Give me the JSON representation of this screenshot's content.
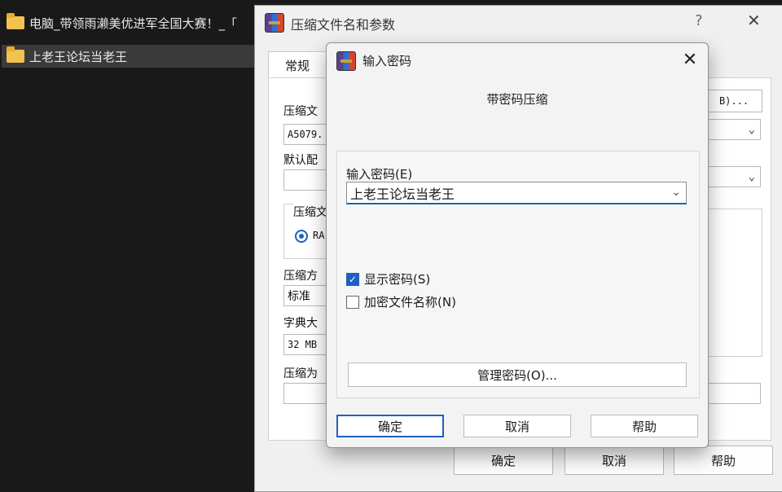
{
  "explorer": {
    "items": [
      {
        "label": "电脑_带领雨濑美优进军全国大赛！_「"
      },
      {
        "label": "上老王论坛当老王"
      }
    ]
  },
  "main_dialog": {
    "title": "压缩文件名和参数",
    "help": "?",
    "close": "✕",
    "tabs": {
      "general": "常规"
    },
    "labels": {
      "archive_name": "压缩文",
      "default_profile": "默认配",
      "archive_format": "压缩文",
      "compression_method": "压缩方",
      "dictionary_size": "字典大",
      "split": "压缩为"
    },
    "values": {
      "archive_name": "A5079.",
      "compression_method": "标准",
      "dictionary_size": "32 MB",
      "format_radio": "RA"
    },
    "right_button": "B)...",
    "bottom_buttons": {
      "ok": "确定",
      "cancel": "取消",
      "help": "帮助"
    }
  },
  "pwd_dialog": {
    "title": "输入密码",
    "close": "✕",
    "header": "带密码压缩",
    "password_label": "输入密码(E)",
    "password_value": "上老王论坛当老王",
    "checkboxes": {
      "show_password": {
        "label": "显示密码(S)",
        "checked": true
      },
      "encrypt_filenames": {
        "label": "加密文件名称(N)",
        "checked": false
      }
    },
    "manage_button": "管理密码(O)...",
    "buttons": {
      "ok": "确定",
      "cancel": "取消",
      "help": "帮助"
    }
  },
  "colors": {
    "accent": "#1f5fbf",
    "background": "#1b1b1b",
    "dialog": "#f0f0f0"
  }
}
